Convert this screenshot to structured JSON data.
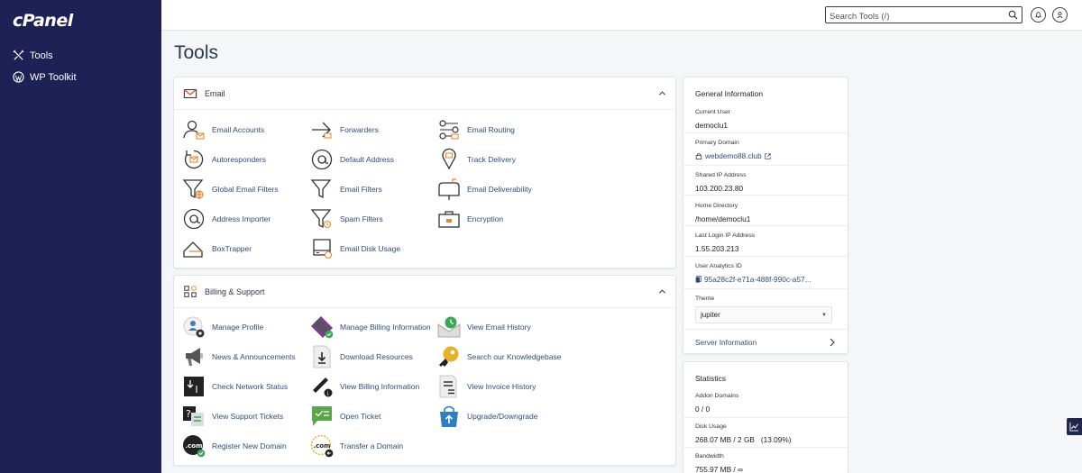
{
  "sidebar": {
    "logo": "cPanel",
    "items": [
      {
        "label": "Tools"
      },
      {
        "label": "WP Toolkit"
      }
    ]
  },
  "header": {
    "search_placeholder": "Search Tools (/)"
  },
  "page": {
    "title": "Tools"
  },
  "email_section": {
    "title": "Email",
    "tools": [
      {
        "label": "Email Accounts"
      },
      {
        "label": "Forwarders"
      },
      {
        "label": "Email Routing"
      },
      {
        "label": "Autoresponders"
      },
      {
        "label": "Default Address"
      },
      {
        "label": "Track Delivery"
      },
      {
        "label": "Global Email Filters"
      },
      {
        "label": "Email Filters"
      },
      {
        "label": "Email Deliverability"
      },
      {
        "label": "Address Importer"
      },
      {
        "label": "Spam Filters"
      },
      {
        "label": "Encryption"
      },
      {
        "label": "BoxTrapper"
      },
      {
        "label": "Email Disk Usage"
      }
    ]
  },
  "billing_section": {
    "title": "Billing & Support",
    "tools": [
      {
        "label": "Manage Profile"
      },
      {
        "label": "Manage Billing Information"
      },
      {
        "label": "View Email History"
      },
      {
        "label": "News & Announcements"
      },
      {
        "label": "Download Resources"
      },
      {
        "label": "Search our Knowledgebase"
      },
      {
        "label": "Check Network Status"
      },
      {
        "label": "View Billing Information"
      },
      {
        "label": "View Invoice History"
      },
      {
        "label": "View Support Tickets"
      },
      {
        "label": "Open Ticket"
      },
      {
        "label": "Upgrade/Downgrade"
      },
      {
        "label": "Register New Domain"
      },
      {
        "label": "Transfer a Domain"
      }
    ],
    "icon_text": ".com"
  },
  "general_info": {
    "title": "General Information",
    "current_user_label": "Current User",
    "current_user": "democlu1",
    "primary_domain_label": "Primary Domain",
    "primary_domain": "webdemo88.club",
    "shared_ip_label": "Shared IP Address",
    "shared_ip": "103.200.23.80",
    "home_dir_label": "Home Directory",
    "home_dir": "/home/democlu1",
    "last_login_label": "Last Login IP Address",
    "last_login": "1.55.203.213",
    "analytics_label": "User Analytics ID",
    "analytics_id": "95a28c2f-e71a-488f-990c-a57...",
    "theme_label": "Theme",
    "theme_value": "jupiter",
    "server_info": "Server Information"
  },
  "statistics": {
    "title": "Statistics",
    "addon_label": "Addon Domains",
    "addon_value": "0 / 0",
    "disk_label": "Disk Usage",
    "disk_value": "268.07 MB / 2 GB   (13.09%)",
    "bandwidth_label": "Bandwidth",
    "bandwidth_value": "755.97 MB / ∞"
  },
  "colors": {
    "sidebar_bg": "#1d2156",
    "link": "#2d4e7b",
    "accent_orange": "#e8842c",
    "check_green": "#3aa657"
  }
}
